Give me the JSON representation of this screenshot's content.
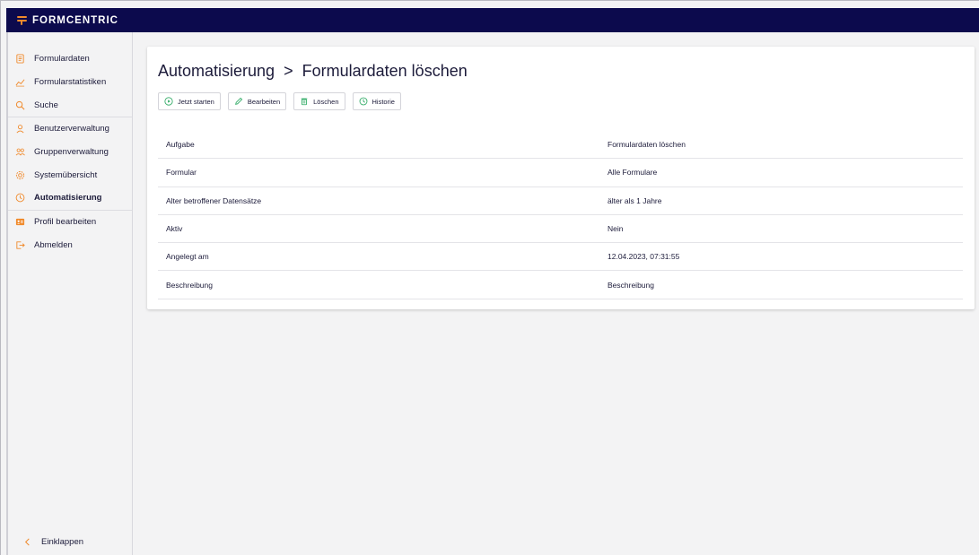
{
  "app": {
    "brand": "FORMCENTRIC",
    "accent": "#f08a2c",
    "topbar_color": "#0c0a4d",
    "icon_color": "#f08a2c",
    "action_icon_color": "#2aa861"
  },
  "sidebar": {
    "groups": [
      [
        {
          "label": "Formulardaten",
          "icon": "document-icon"
        },
        {
          "label": "Formularstatistiken",
          "icon": "chart-line-icon"
        },
        {
          "label": "Suche",
          "icon": "search-icon"
        }
      ],
      [
        {
          "label": "Benutzerverwaltung",
          "icon": "user-icon"
        },
        {
          "label": "Gruppenverwaltung",
          "icon": "users-icon"
        },
        {
          "label": "Systemübersicht",
          "icon": "gear-icon"
        },
        {
          "label": "Automatisierung",
          "icon": "clock-icon",
          "active": true
        }
      ],
      [
        {
          "label": "Profil bearbeiten",
          "icon": "id-card-icon"
        },
        {
          "label": "Abmelden",
          "icon": "logout-icon"
        }
      ]
    ],
    "collapse_label": "Einklappen"
  },
  "main": {
    "breadcrumb_parent": "Automatisierung",
    "breadcrumb_sep": ">",
    "breadcrumb_current": "Formulardaten löschen",
    "toolbar": [
      {
        "label": "Jetzt starten",
        "icon": "play-icon"
      },
      {
        "label": "Bearbeiten",
        "icon": "pencil-icon"
      },
      {
        "label": "Löschen",
        "icon": "trash-icon"
      },
      {
        "label": "Historie",
        "icon": "clock-icon"
      }
    ],
    "details": [
      {
        "key": "Aufgabe",
        "value": "Formulardaten löschen"
      },
      {
        "key": "Formular",
        "value": "Alle Formulare"
      },
      {
        "key": "Alter betroffener Datensätze",
        "value": "älter als 1 Jahre"
      },
      {
        "key": "Aktiv",
        "value": "Nein"
      },
      {
        "key": "Angelegt am",
        "value": "12.04.2023, 07:31:55"
      },
      {
        "key": "Beschreibung",
        "value": "Beschreibung"
      }
    ]
  }
}
